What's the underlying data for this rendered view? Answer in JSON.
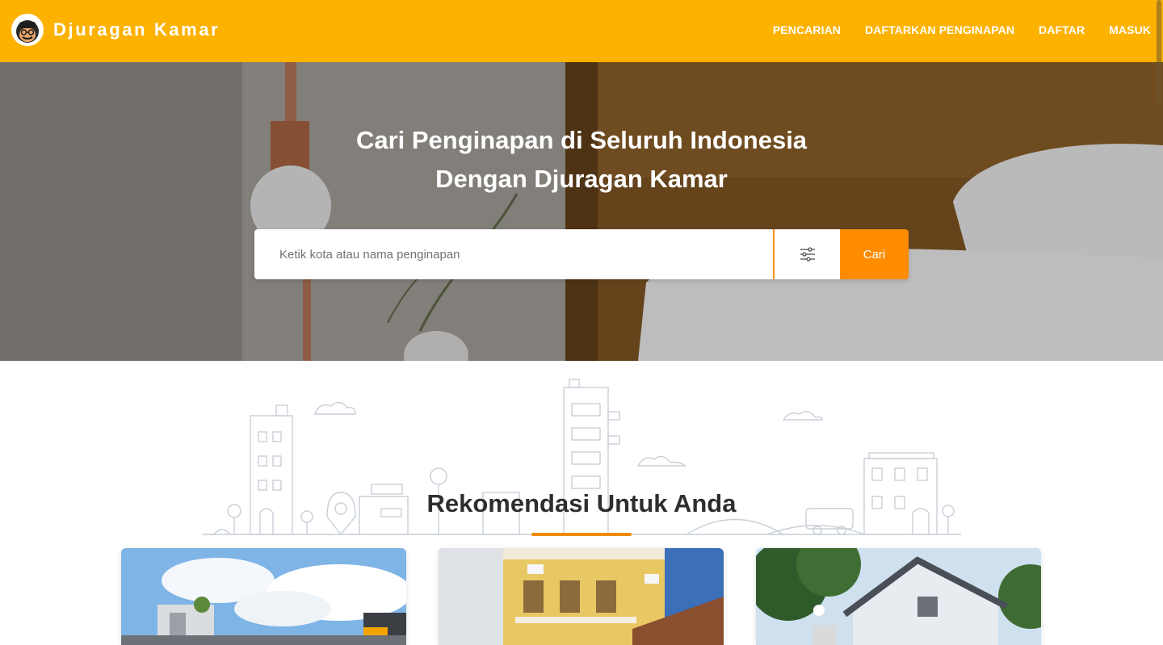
{
  "brand": {
    "name": "Djuragan Kamar",
    "logo_icon": "mascot-face-icon"
  },
  "nav": {
    "items": [
      {
        "label": "PENCARIAN"
      },
      {
        "label": "DAFTARKAN PENGINAPAN"
      },
      {
        "label": "DAFTAR"
      },
      {
        "label": "MASUK"
      }
    ]
  },
  "hero": {
    "title_line1": "Cari Penginapan di Seluruh Indonesia",
    "title_line2": "Dengan Djuragan Kamar"
  },
  "search": {
    "placeholder": "Ketik kota atau nama penginapan",
    "value": "",
    "filter_icon": "sliders-icon",
    "button_label": "Cari"
  },
  "recommendation": {
    "title": "Rekomendasi Untuk Anda",
    "cards": [
      {
        "image": "house-photo-1"
      },
      {
        "image": "house-photo-2"
      },
      {
        "image": "house-photo-3"
      }
    ]
  },
  "colors": {
    "navbar": "#fdb200",
    "accent": "#ff8b00",
    "underline": "#f08a00",
    "title_text": "#2e2e2e"
  }
}
